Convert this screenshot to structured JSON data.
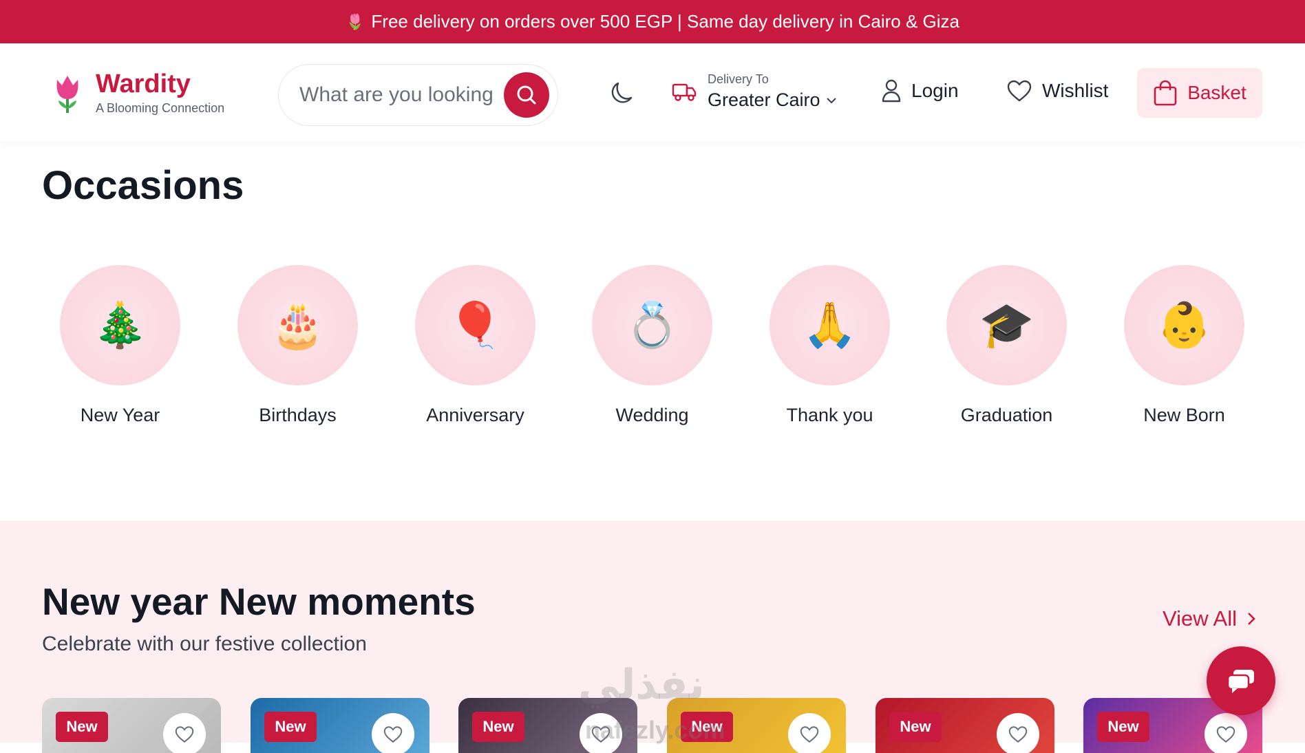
{
  "promo": {
    "icon": "tulip-icon",
    "text": "Free delivery on orders over 500 EGP | Same day delivery in Cairo & Giza"
  },
  "header": {
    "brand": "Wardity",
    "tagline": "A Blooming Connection",
    "search_placeholder": "What are you looking",
    "delivery_label": "Delivery To",
    "delivery_city": "Greater Cairo",
    "login": "Login",
    "wishlist": "Wishlist",
    "basket": "Basket"
  },
  "occasions": {
    "title": "Occasions",
    "items": [
      {
        "label": "New Year",
        "emoji": "🎄"
      },
      {
        "label": "Birthdays",
        "emoji": "🎂"
      },
      {
        "label": "Anniversary",
        "emoji": "🎈"
      },
      {
        "label": "Wedding",
        "emoji": "💍"
      },
      {
        "label": "Thank you",
        "emoji": "🙏"
      },
      {
        "label": "Graduation",
        "emoji": "🎓"
      },
      {
        "label": "New Born",
        "emoji": "👶"
      }
    ]
  },
  "collection": {
    "title": "New year New moments",
    "subtitle": "Celebrate with our festive collection",
    "view_all": "View All",
    "cards": [
      {
        "badge": "New",
        "bg": "linear-gradient(135deg,#d9d9d9,#b9b9b9)"
      },
      {
        "badge": "New",
        "bg": "linear-gradient(135deg,#1d6aa8,#5aa6d6)"
      },
      {
        "badge": "New",
        "bg": "linear-gradient(135deg,#3a3140,#7c6a80)"
      },
      {
        "badge": "New",
        "bg": "linear-gradient(135deg,#d8a12a,#f2c233)"
      },
      {
        "badge": "New",
        "bg": "linear-gradient(135deg,#b3172a,#e0453c)"
      },
      {
        "badge": "New",
        "bg": "linear-gradient(135deg,#5b2fa4,#e94c8c)"
      }
    ]
  },
  "watermark": {
    "line1": "نفذلي",
    "line2": "nafezly.com"
  },
  "colors": {
    "brand": "#c8193f",
    "basket_bg": "#fde9ee",
    "section_bg": "#fdeef1"
  }
}
